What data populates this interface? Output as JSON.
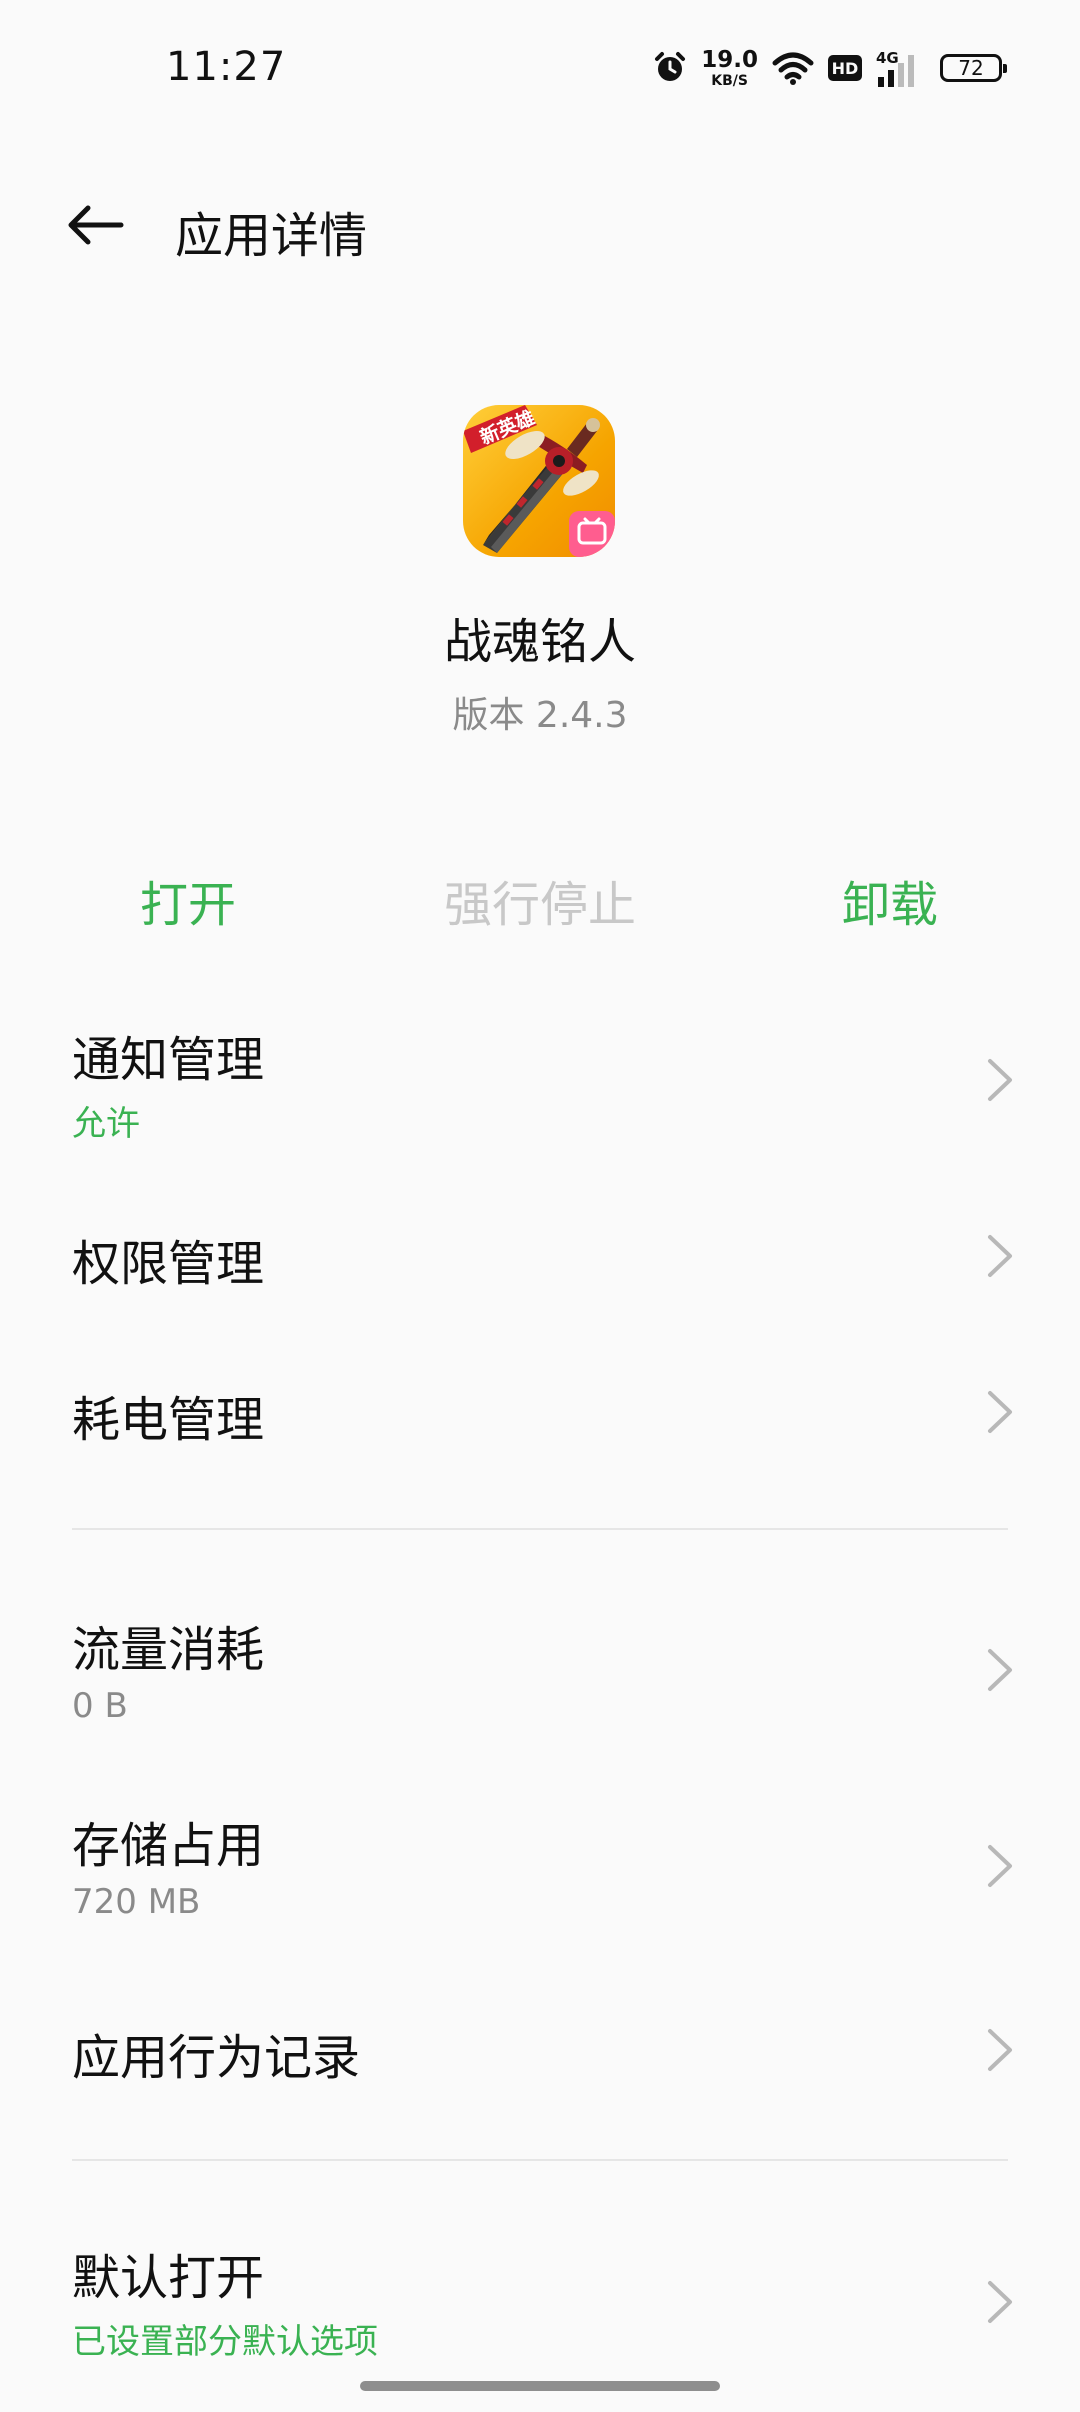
{
  "status_bar": {
    "time": "11:27",
    "net_speed_value": "19.0",
    "net_speed_unit": "KB/S",
    "hd_label": "HD",
    "network_label": "4G",
    "battery_level": "72",
    "icons": [
      "alarm-icon",
      "wifi-icon",
      "signal-icon",
      "battery-icon"
    ]
  },
  "header": {
    "back_icon": "arrow-left-icon",
    "title": "应用详情"
  },
  "app": {
    "icon_badge": "新英雄",
    "name": "战魂铭人",
    "version": "版本 2.4.3"
  },
  "actions": {
    "open": "打开",
    "force_stop": "强行停止",
    "uninstall": "卸载",
    "colors": {
      "enabled": "#3ab252",
      "disabled": "#c8c8c8"
    }
  },
  "settings": {
    "notification": {
      "title": "通知管理",
      "subtitle": "允许"
    },
    "permission": {
      "title": "权限管理"
    },
    "battery": {
      "title": "耗电管理"
    },
    "data_usage": {
      "title": "流量消耗",
      "subtitle": "0 B"
    },
    "storage": {
      "title": "存储占用",
      "subtitle": "720 MB"
    },
    "behavior": {
      "title": "应用行为记录"
    },
    "default_open": {
      "title": "默认打开",
      "subtitle": "已设置部分默认选项"
    },
    "chevron_icon": "chevron-right-icon"
  }
}
